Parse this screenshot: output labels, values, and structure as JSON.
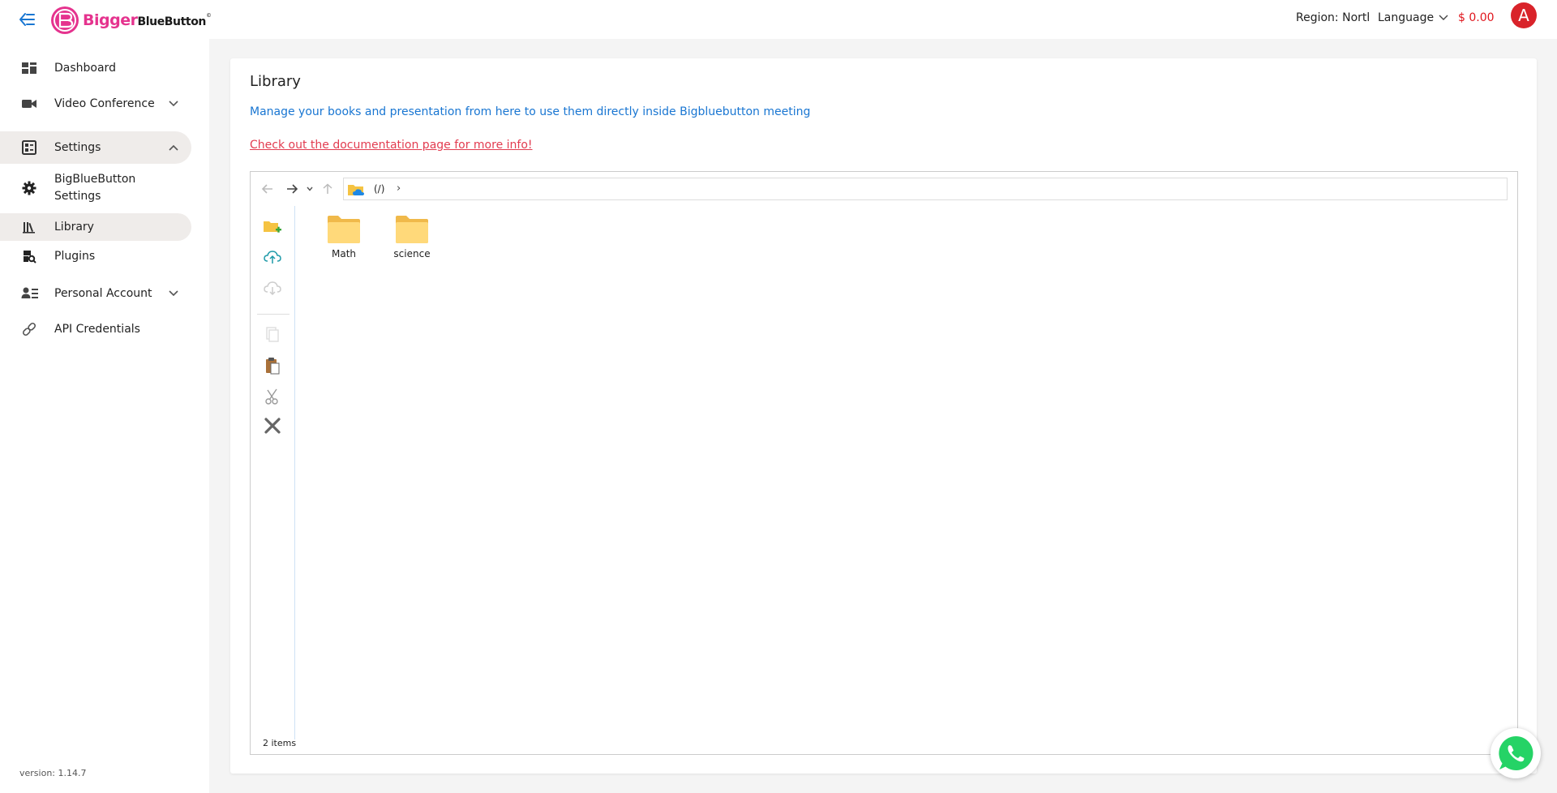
{
  "brand": {
    "logo_part1": "Bigger",
    "logo_part2": "BlueButton",
    "logo_mark": "©"
  },
  "header": {
    "region_label": "Region: North",
    "language_label": "Language",
    "balance": "$ 0.00",
    "avatar_initial": "A"
  },
  "sidebar": {
    "items": [
      {
        "label": "Dashboard",
        "icon": "dashboard-icon"
      },
      {
        "label": "Video Conference",
        "icon": "video-camera-icon"
      },
      {
        "label": "Settings",
        "icon": "settings-panel-icon"
      },
      {
        "label": "BigBlueButton Settings",
        "label_line1": "BigBlueButton",
        "label_line2": "Settings",
        "icon": "gear-icon"
      },
      {
        "label": "Library",
        "icon": "library-icon"
      },
      {
        "label": "Plugins",
        "icon": "plugins-icon"
      },
      {
        "label": "Personal Account",
        "icon": "personal-account-icon"
      },
      {
        "label": "API Credentials",
        "icon": "link-icon"
      }
    ],
    "version": "version: 1.14.7"
  },
  "main": {
    "title": "Library",
    "description": "Manage your books and presentation from here to use them directly inside Bigbluebutton meeting",
    "doc_link": "Check out the documentation page for more info!"
  },
  "file_manager": {
    "root_label": "(/)",
    "path_separator": "›",
    "items": [
      {
        "name": "Math",
        "type": "folder"
      },
      {
        "name": "science",
        "type": "folder"
      }
    ],
    "status": "2 items"
  },
  "colors": {
    "accent_blue": "#1976d2",
    "link_red": "#e23c50",
    "balance_red": "#e0161d",
    "avatar_red": "#d9232a",
    "brand_pink": "#e5338e",
    "folder_yellow": "#ffd97a"
  }
}
